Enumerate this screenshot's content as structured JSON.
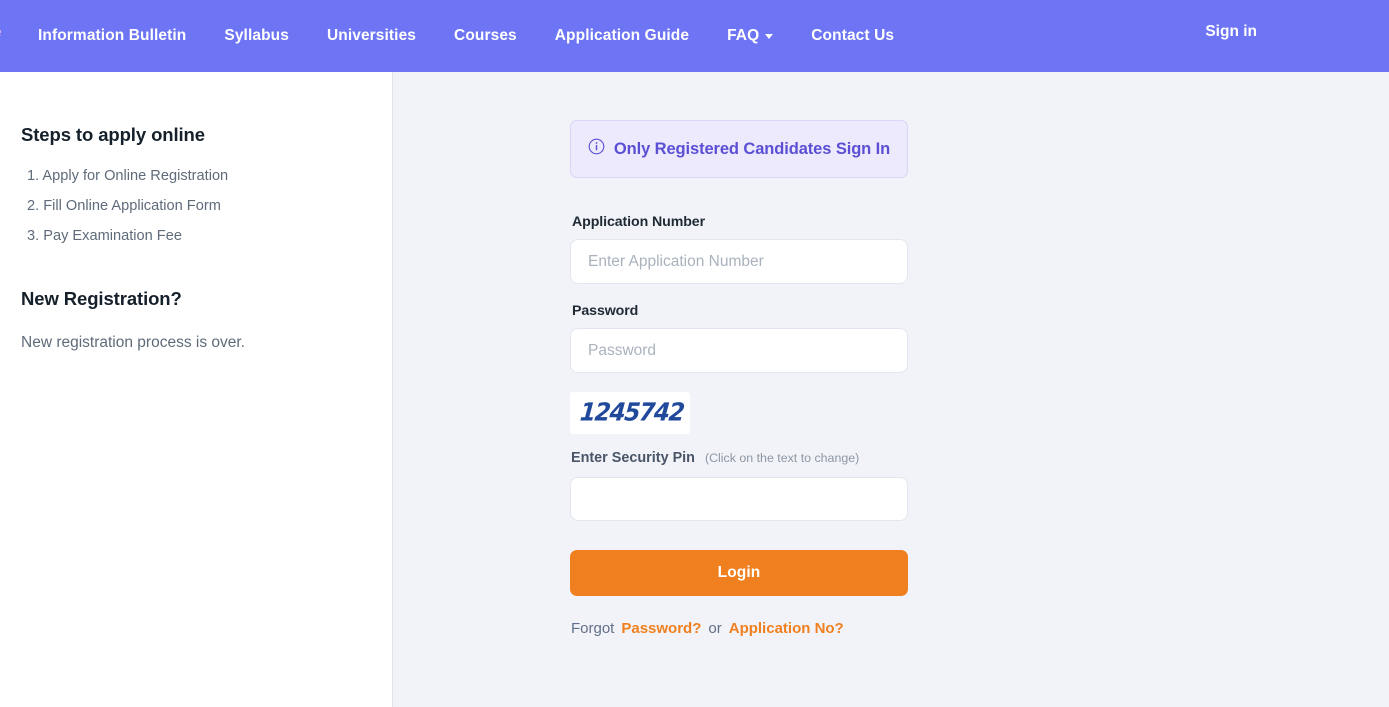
{
  "navbar": {
    "brand_sliver": "e",
    "items": [
      {
        "label": "Information Bulletin",
        "has_caret": false
      },
      {
        "label": "Syllabus",
        "has_caret": false
      },
      {
        "label": "Universities",
        "has_caret": false
      },
      {
        "label": "Courses",
        "has_caret": false
      },
      {
        "label": "Application Guide",
        "has_caret": false
      },
      {
        "label": "FAQ",
        "has_caret": true
      },
      {
        "label": "Contact Us",
        "has_caret": false
      }
    ],
    "sign_in": "Sign in",
    "background_color": "#6d75f4",
    "text_color": "#ffffff"
  },
  "sidebar": {
    "steps_heading": "Steps to apply online",
    "steps": [
      "1. Apply for Online Registration",
      "2. Fill Online Application Form",
      "3. Pay Examination Fee"
    ],
    "registration_heading": "New Registration?",
    "registration_note": "New registration process is over."
  },
  "login": {
    "alert": {
      "text": "Only Registered Candidates Sign In",
      "icon": "info-circle-icon",
      "background_color": "#eceafc",
      "text_color": "#5b4fd4"
    },
    "application_number": {
      "label": "Application Number",
      "placeholder": "Enter Application Number",
      "value": ""
    },
    "password": {
      "label": "Password",
      "placeholder": "Password",
      "value": ""
    },
    "captcha": {
      "code": "1245742",
      "label": "Enter Security Pin",
      "hint": "(Click on the text to change)",
      "text_color": "#20489b",
      "value": ""
    },
    "submit_label": "Login",
    "submit_color": "#f0801f",
    "forgot": {
      "prefix": "Forgot",
      "password_link": "Password?",
      "separator": "or",
      "application_link": "Application No?",
      "link_color": "#f0801f"
    }
  }
}
